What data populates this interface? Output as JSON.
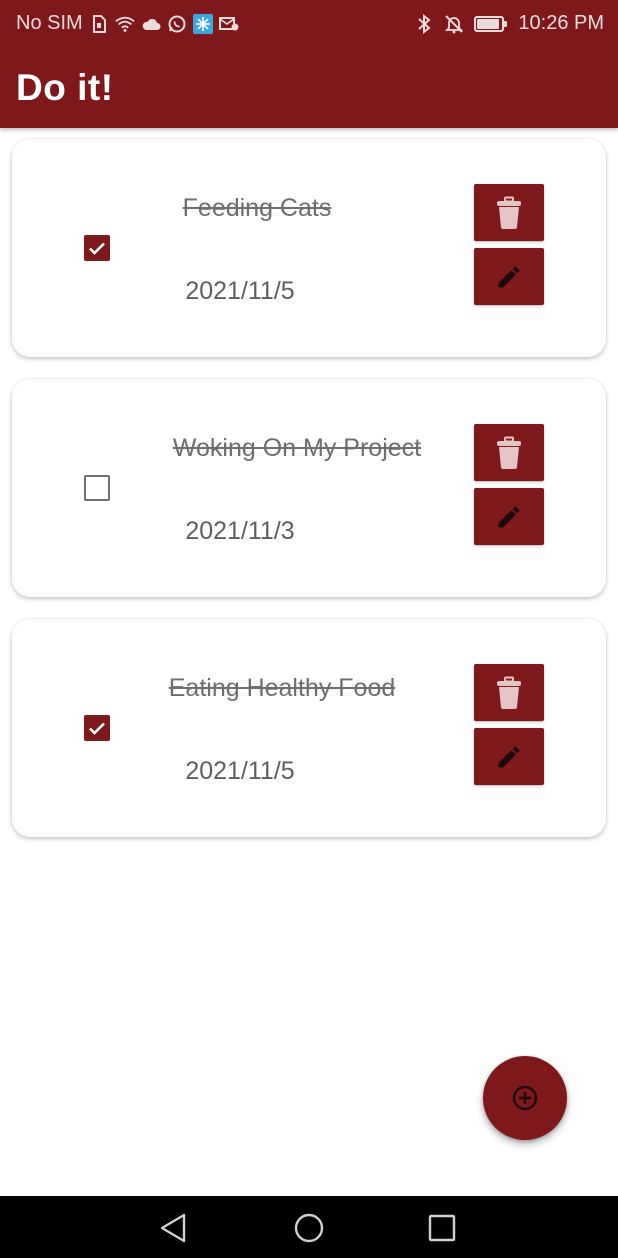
{
  "status_bar": {
    "carrier": "No SIM",
    "time": "10:26 PM",
    "left_icons": [
      "sim-card-icon",
      "wifi-icon",
      "cloud-icon",
      "whatsapp-icon",
      "app-icon",
      "mail-icon"
    ],
    "right_icons": [
      "bluetooth-icon",
      "notifications-off-icon",
      "battery-icon"
    ]
  },
  "app_bar": {
    "title": "Do it!"
  },
  "colors": {
    "primary": "#7e181b",
    "text_muted": "#6e6e6e",
    "background": "#ffffff"
  },
  "tasks": [
    {
      "title": "Feeding Cats",
      "date": "2021/11/5",
      "completed": true
    },
    {
      "title": "Woking On My Project",
      "date": "2021/11/3",
      "completed": false
    },
    {
      "title": "Eating Healthy Food",
      "date": "2021/11/5",
      "completed": true
    }
  ],
  "task_actions": {
    "delete_icon": "trash-icon",
    "edit_icon": "pencil-icon"
  },
  "fab": {
    "icon": "add-circle-icon"
  },
  "nav_bar": {
    "buttons": [
      "back-icon",
      "home-icon",
      "recents-icon"
    ]
  }
}
